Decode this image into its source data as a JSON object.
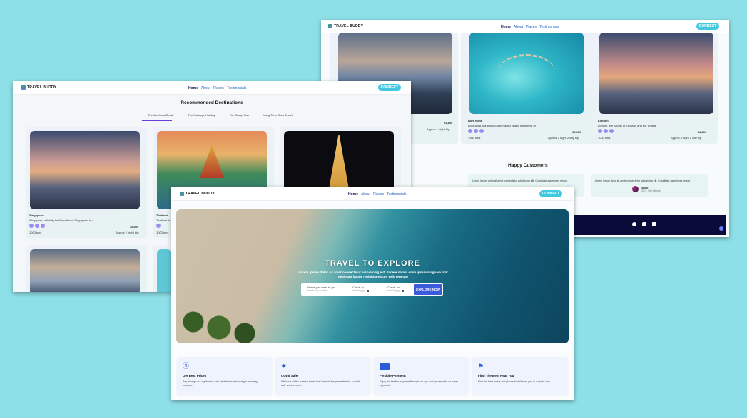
{
  "brand": "TRAVEL BUDDY",
  "nav_links": [
    "Home",
    "About",
    "Places",
    "Testimonials"
  ],
  "connect_label": "CONNECT",
  "back_window": {
    "cards": [
      {
        "price": "24,100",
        "duration": "Approx 1 night trip"
      },
      {
        "name": "Bora Bora",
        "desc": "Bora Bora is a small South Pacific island northwest of",
        "price": "95,400",
        "distance": "7000 kms",
        "duration": "Approx 2 night 2 day trip"
      },
      {
        "name": "London",
        "desc": "London, the capital of England and the United",
        "price": "38,800",
        "distance": "7000 kms",
        "duration": "Approx 3 night 2 day trip"
      }
    ],
    "happy_title": "Happy Customers",
    "testimonial_text": "Lorem ipsum dolor sit amet consectetur adipisicing elit. Cupiditate asperiores seque.",
    "testimonial_name": "Tamar",
    "testimonial_role": "CEO · This Website"
  },
  "middle_window": {
    "title": "Recommended Destinations",
    "tabs": [
      "The Weekend Break",
      "The Package Holiday",
      "The Group Tour",
      "Long Term Slow Travel"
    ],
    "cards": [
      {
        "name": "Singapore",
        "desc": "Singapore, officially the Republic of Singapore, is a",
        "price": "38,800",
        "distance": "1000 kms",
        "duration": "Approx 2 night trip"
      },
      {
        "name": "Thailand",
        "desc": "Thailand is",
        "distance": "1000 kms"
      }
    ]
  },
  "front_window": {
    "hero_title": "TRAVEL TO EXPLORE",
    "hero_sub": "Lorem ipsum dolor sit amet consectetur adipisicing elit. Facere natus, enim ipsam magnam odit deserunt itaque? Minima earum velit tenetur!",
    "search": {
      "where_label": "Where you want to go",
      "where_placeholder": "Search Your location",
      "checkin_label": "Check-in",
      "checkin_value": "mm/dd/yyyy",
      "checkout_label": "Check-out",
      "checkout_value": "mm/dd/yyyy",
      "button": "EXPLORE NOW"
    },
    "features": [
      {
        "icon": "price-tag-icon",
        "title": "Get Best Prices",
        "desc": "Pay through our application and save thousands and get amazing rewards."
      },
      {
        "icon": "virus-icon",
        "title": "Covid Safe",
        "desc": "We have all the curated hotels that have all the precaution for a covid safe environment."
      },
      {
        "icon": "credit-card-icon",
        "title": "Flexible Payment",
        "desc": "Enjoy the flexible payment through our app and get rewards on every payment."
      },
      {
        "icon": "location-pin-icon",
        "title": "Find The Best Near You",
        "desc": "Find the best hotels and places to visit near you in a single click."
      }
    ]
  },
  "colors": {
    "background": "#8ee0e8",
    "accent": "#42c8e0",
    "primary_button": "#3b5bdb",
    "footer": "#0b0b3b"
  }
}
